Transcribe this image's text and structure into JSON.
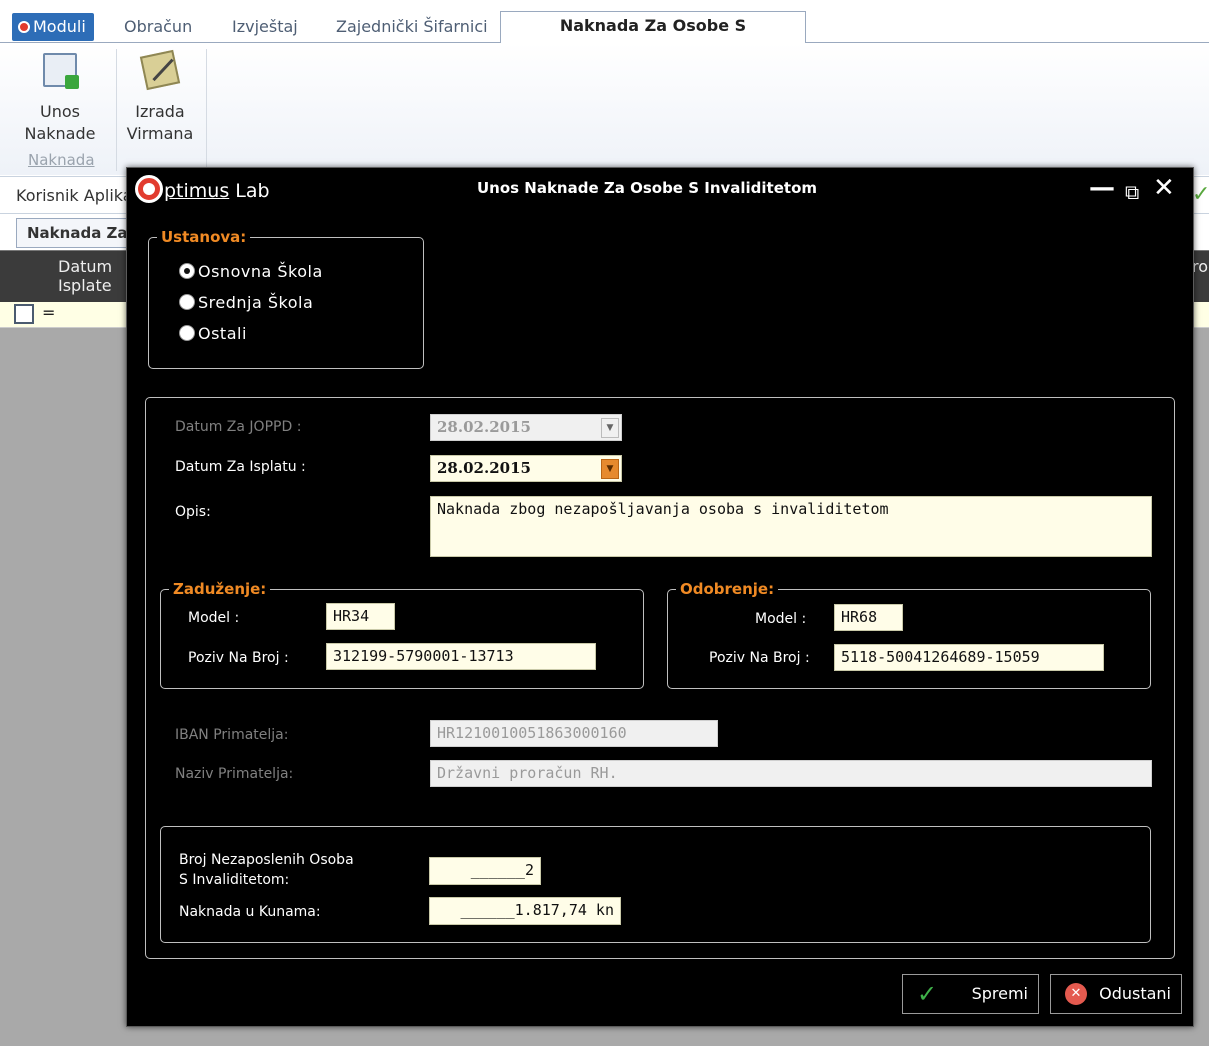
{
  "tabs": {
    "moduli": "Moduli",
    "obracun": "Obračun",
    "izvjestaj": "Izvještaj",
    "sifarnici": "Zajednički Šifarnici",
    "active": "Naknada Za Osobe S Invaliditetom"
  },
  "ribbon": {
    "unos_line1": "Unos",
    "unos_line2": "Naknade",
    "izrada_line1": "Izrada",
    "izrada_line2": "Virmana",
    "group_label": "Naknada"
  },
  "background": {
    "korisnik": "Korisnik Aplika",
    "subtab": "Naknada Za O",
    "col_datum_1": "Datum",
    "col_datum_2": "Isplate",
    "col_right": "ro",
    "filter_eq": "="
  },
  "modal": {
    "logo_tail": "ptimus",
    "logo_lab": " Lab",
    "title": "Unos Naknade Za Osobe S Invaliditetom",
    "ustanova": {
      "legend": "Ustanova:",
      "options": [
        "Osnovna Škola",
        "Srednja Škola",
        "Ostali"
      ],
      "selected_index": 0
    },
    "datum_joppd_label": "Datum Za JOPPD :",
    "datum_joppd_value": "28.02.2015",
    "datum_isplata_label": "Datum Za Isplatu :",
    "datum_isplata_value": "28.02.2015",
    "opis_label": "Opis:",
    "opis_value": "Naknada zbog nezapošljavanja osoba s invaliditetom",
    "zaduzenje": {
      "legend": "Zaduženje:",
      "model_label": "Model :",
      "model_value": "HR34",
      "poziv_label": "Poziv Na Broj :",
      "poziv_value": "312199-5790001-13713"
    },
    "odobrenje": {
      "legend": "Odobrenje:",
      "model_label": "Model :",
      "model_value": "HR68",
      "poziv_label": "Poziv Na Broj :",
      "poziv_value": "5118-50041264689-15059"
    },
    "iban_label": "IBAN Primatelja:",
    "iban_value": "HR1210010051863000160",
    "naziv_label": "Naziv Primatelja:",
    "naziv_value": "Državni proračun RH.",
    "broj_label_1": "Broj Nezaposlenih Osoba",
    "broj_label_2": "S Invaliditetom:",
    "broj_value": "______2",
    "naknada_label": "Naknada u Kunama:",
    "naknada_value": "______1.817,74 kn",
    "spremi": "Spremi",
    "odustani": "Odustani"
  },
  "colors": {
    "accent_orange": "#f08a24",
    "modal_bg": "#000000",
    "tab_blue": "#2d6db7",
    "input_bg": "#fffde8"
  }
}
